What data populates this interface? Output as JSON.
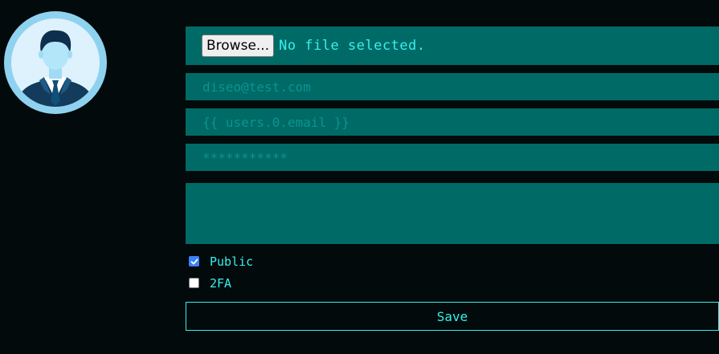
{
  "profile": {
    "avatar_icon": "user-avatar-icon"
  },
  "file_upload": {
    "browse_label": "Browse...",
    "status": "No file selected."
  },
  "form": {
    "email_placeholder": "diseo@test.com",
    "email_template_placeholder": "{{ users.0.email }}",
    "password_placeholder": "***********",
    "bio_value": ""
  },
  "options": {
    "public_label": "Public",
    "public_checked": true,
    "twofa_label": "2FA",
    "twofa_checked": false
  },
  "actions": {
    "save_label": "Save"
  },
  "colors": {
    "background": "#020a0b",
    "field": "#006a66",
    "accent": "#36f0ee",
    "placeholder": "#0c9391",
    "checkbox_checked": "#3b82f6"
  }
}
